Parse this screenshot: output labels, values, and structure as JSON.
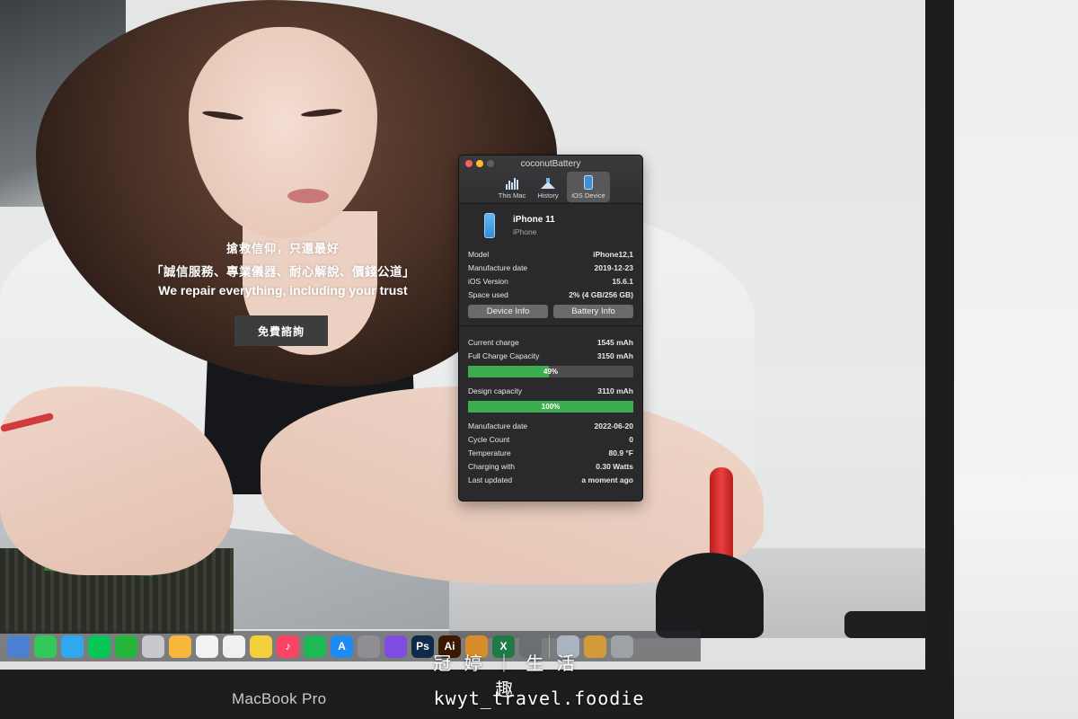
{
  "website": {
    "slogan_line1": "搶救信仰，只還最好",
    "slogan_line2": "「誠信服務、專業儀器、耐心解說、價錢公道」",
    "slogan_line3": "We repair everything, including your trust",
    "consult_button": "免費諮詢"
  },
  "coconut_battery": {
    "title": "coconutBattery",
    "tabs": [
      {
        "label": "This Mac",
        "icon": "bar-chart-icon"
      },
      {
        "label": "History",
        "icon": "history-icon"
      },
      {
        "label": "iOS Device",
        "icon": "iphone-icon",
        "active": true
      }
    ],
    "device": {
      "name": "iPhone 11",
      "type": "iPhone",
      "model_label": "Model",
      "model": "iPhone12,1",
      "manufacture_label": "Manufacture date",
      "manufacture_date": "2019-12-23",
      "ios_label": "iOS Version",
      "ios_version": "15.6.1",
      "space_label": "Space used",
      "space_used": "2% (4 GB/256 GB)",
      "device_info_button": "Device Info",
      "battery_info_button": "Battery Info"
    },
    "battery": {
      "current_charge_label": "Current charge",
      "current_charge": "1545 mAh",
      "full_charge_label": "Full Charge Capacity",
      "full_charge": "3150 mAh",
      "charge_percent_text": "49%",
      "charge_fraction": 0.49,
      "design_capacity_label": "Design capacity",
      "design_capacity": "3110 mAh",
      "health_percent_text": "100%",
      "health_fraction": 1.0,
      "manufacture_label": "Manufacture date",
      "manufacture_date": "2022-06-20",
      "cycle_label": "Cycle Count",
      "cycle_count": "0",
      "temperature_label": "Temperature",
      "temperature": "80.9 °F",
      "charging_label": "Charging with",
      "charging_with": "0.30 Watts",
      "updated_label": "Last updated",
      "last_updated": "a moment ago"
    },
    "bar_color": "#3cae4f"
  },
  "dock": {
    "apps": [
      {
        "name": "preview",
        "color": "#4a7fd1",
        "glyph": ""
      },
      {
        "name": "facetime",
        "color": "#34c759",
        "glyph": ""
      },
      {
        "name": "messages",
        "color": "#2fa8f0",
        "glyph": ""
      },
      {
        "name": "line",
        "color": "#06c755",
        "glyph": ""
      },
      {
        "name": "wechat",
        "color": "#24b53b",
        "glyph": ""
      },
      {
        "name": "image-capture",
        "color": "#c7c9cc",
        "glyph": ""
      },
      {
        "name": "photos",
        "color": "#f5b83a",
        "glyph": ""
      },
      {
        "name": "calendar",
        "color": "#f2f2f2",
        "glyph": ""
      },
      {
        "name": "notes-doc",
        "color": "#f0f0f0",
        "glyph": ""
      },
      {
        "name": "stickies",
        "color": "#f4d03f",
        "glyph": ""
      },
      {
        "name": "music",
        "color": "#fb4463",
        "glyph": "♪"
      },
      {
        "name": "spotify",
        "color": "#1db954",
        "glyph": ""
      },
      {
        "name": "app-store",
        "color": "#1d8cf2",
        "glyph": "A"
      },
      {
        "name": "system-preferences",
        "color": "#8e8e93",
        "glyph": ""
      },
      {
        "name": "imovie",
        "color": "#7e4ce0",
        "glyph": ""
      },
      {
        "name": "photoshop",
        "color": "#0d2a48",
        "glyph": "Ps"
      },
      {
        "name": "illustrator",
        "color": "#3b1800",
        "glyph": "Ai"
      },
      {
        "name": "transmit",
        "color": "#d98c2b",
        "glyph": ""
      },
      {
        "name": "excel",
        "color": "#1e7b45",
        "glyph": "X"
      },
      {
        "name": "xcode-tool",
        "color": "#6b6e73",
        "glyph": ""
      },
      {
        "name": "image-stack",
        "color": "#aab4c0",
        "glyph": ""
      },
      {
        "name": "downloads-stack",
        "color": "#d39a3a",
        "glyph": ""
      },
      {
        "name": "trash",
        "color": "#9ea2a7",
        "glyph": ""
      }
    ]
  },
  "laptop_label": "MacBook Pro",
  "watermark": {
    "line1": "冠 婷 ｜ 生 活 趣",
    "line2": "kwyt_travel.foodie"
  }
}
